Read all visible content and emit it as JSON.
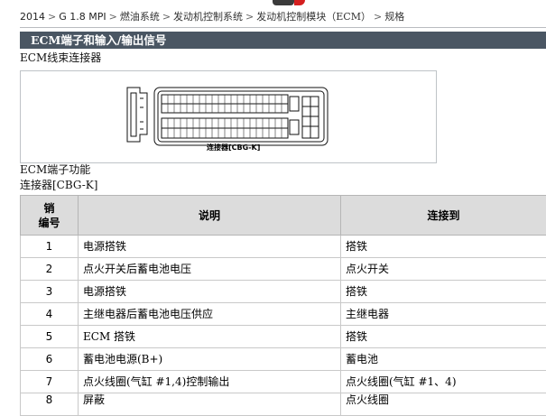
{
  "breadcrumb": {
    "items": [
      "2014",
      "G 1.8 MPI",
      "燃油系统",
      "发动机控制系统",
      "发动机控制模块（ECM）",
      "规格"
    ],
    "separator": ">"
  },
  "section": {
    "title": "ECM端子和输入/输出信号"
  },
  "harness": {
    "label": "ECM线束连接器",
    "figure_caption": "连接器[CBG-K]"
  },
  "terminal_function": {
    "label": "ECM端子功能",
    "connector_label": "连接器[CBG-K]"
  },
  "table": {
    "headers": {
      "pin_line1": "销",
      "pin_line2": "编号",
      "description": "说明",
      "connected_to": "连接到"
    },
    "rows": [
      {
        "pin": "1",
        "description": "电源搭铁",
        "connected_to": "搭铁"
      },
      {
        "pin": "2",
        "description": "点火开关后蓄电池电压",
        "connected_to": "点火开关"
      },
      {
        "pin": "3",
        "description": "电源搭铁",
        "connected_to": "搭铁"
      },
      {
        "pin": "4",
        "description": "主继电器后蓄电池电压供应",
        "connected_to": "主继电器"
      },
      {
        "pin": "5",
        "description": "ECM 搭铁",
        "connected_to": "搭铁"
      },
      {
        "pin": "6",
        "description": "蓄电池电源(B+)",
        "connected_to": "蓄电池"
      },
      {
        "pin": "7",
        "description": "点火线圈(气缸 #1,4)控制输出",
        "connected_to": "点火线圈(气缸 #1、4)"
      },
      {
        "pin": "8",
        "description": "屏蔽",
        "connected_to": "点火线圈"
      }
    ]
  },
  "colors": {
    "section_bar": "#4a5663",
    "table_header_bg": "#dcdcdc",
    "logo_dark": "#3b3b3b",
    "logo_red": "#d41f1f"
  }
}
